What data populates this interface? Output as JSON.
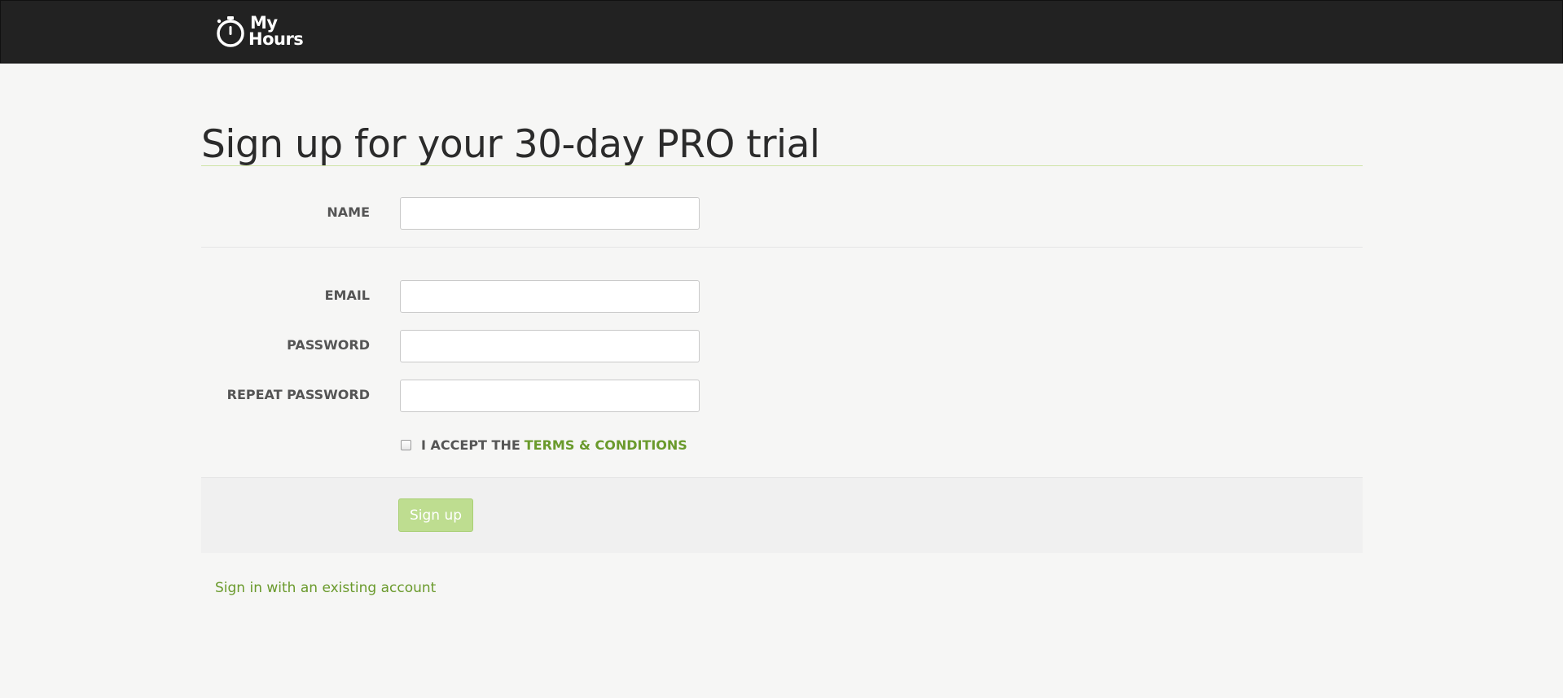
{
  "header": {
    "logo_line1": "My",
    "logo_line2": "Hours",
    "logo_icon": "stopwatch-icon"
  },
  "page": {
    "title": "Sign up for your 30-day PRO trial"
  },
  "form": {
    "name_label": "NAME",
    "name_value": "",
    "email_label": "EMAIL",
    "email_value": "",
    "password_label": "PASSWORD",
    "password_value": "",
    "repeat_password_label": "REPEAT PASSWORD",
    "repeat_password_value": "",
    "terms_prefix": "I ACCEPT THE",
    "terms_link": "TERMS & CONDITIONS",
    "terms_checked": false,
    "submit_label": "Sign up"
  },
  "footer": {
    "signin_link": "Sign in with an existing account"
  },
  "colors": {
    "topbar": "#222222",
    "accent": "#6a9a2c",
    "button": "#bedd90",
    "background": "#f6f6f5"
  }
}
